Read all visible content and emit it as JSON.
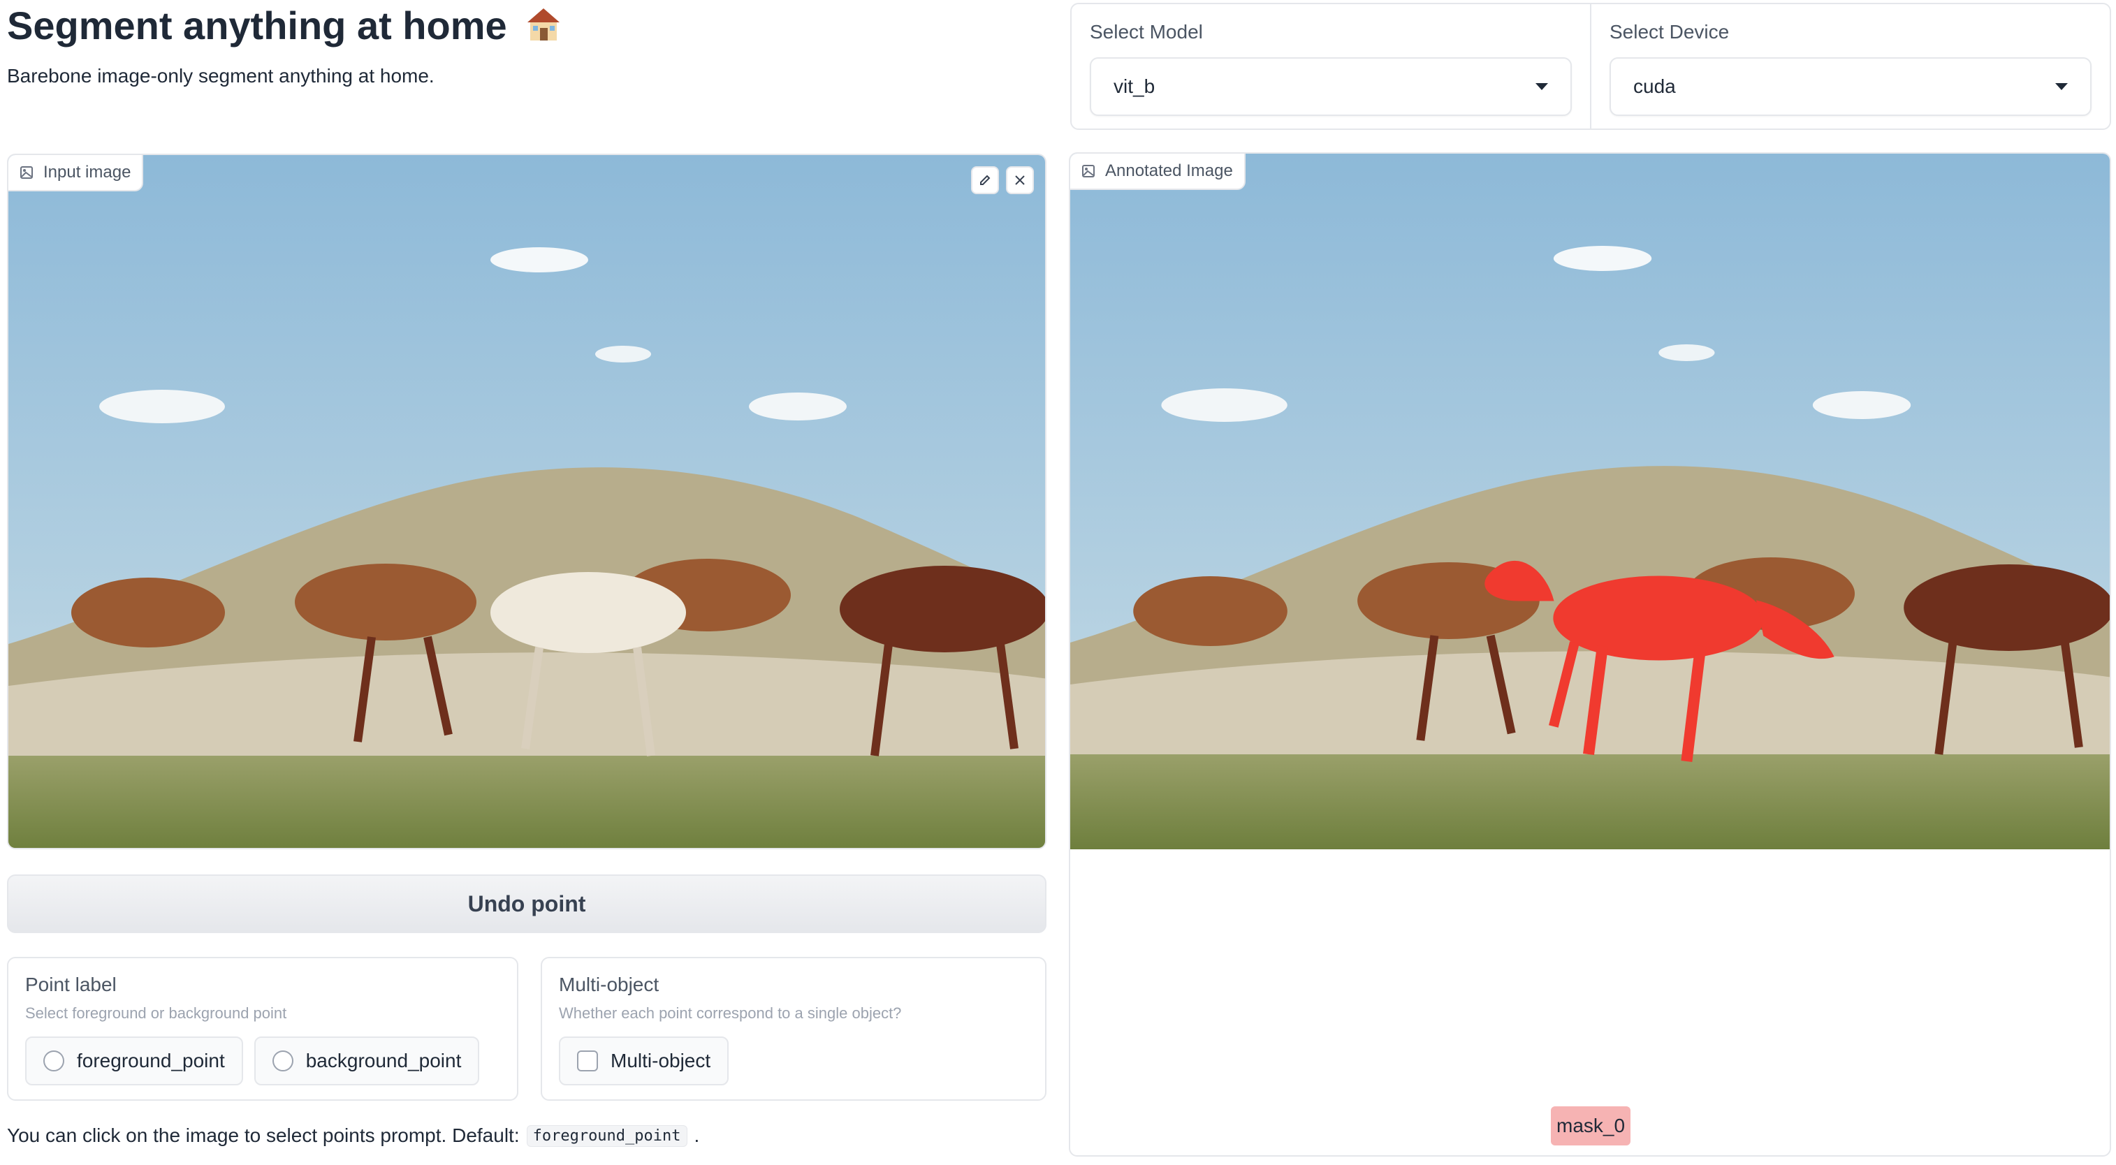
{
  "header": {
    "title": "Segment anything at home",
    "subtitle": "Barebone image-only segment anything at home."
  },
  "settings": {
    "model_label": "Select Model",
    "model_value": "vit_b",
    "device_label": "Select Device",
    "device_value": "cuda"
  },
  "input_image": {
    "label": "Input image",
    "tools": [
      "edit-icon",
      "close-icon"
    ]
  },
  "annotated_image": {
    "label": "Annotated Image",
    "mask_label": "mask_0",
    "mask_color": "#f03a2f"
  },
  "undo_button": "Undo point",
  "point_label": {
    "title": "Point label",
    "info": "Select foreground or background point",
    "options": [
      "foreground_point",
      "background_point"
    ]
  },
  "multi_object": {
    "title": "Multi-object",
    "info": "Whether each point correspond to a single object?",
    "option": "Multi-object"
  },
  "footer": {
    "text": "You can click on the image to select points prompt. Default:",
    "code": "foreground_point",
    "end": "."
  }
}
